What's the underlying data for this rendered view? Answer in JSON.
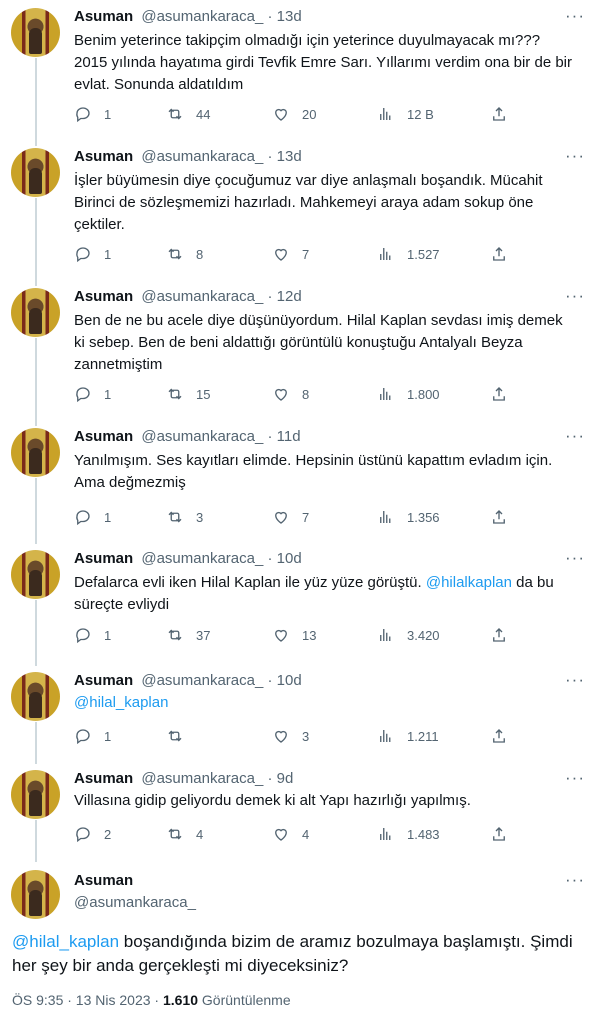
{
  "author": {
    "name": "Asuman",
    "handle": "@asumankaraca_",
    "separator": "·",
    "more": "···"
  },
  "tweets": [
    {
      "time": "13d",
      "lines": [
        "Benim yeterince takipçim olmadığı için yeterince duyulmayacak mı???",
        "2015 yılında hayatıma girdi Tevfik Emre Sarı. Yıllarımı verdim ona bir de bir",
        "evlat. Sonunda aldatıldım"
      ],
      "replies": "1",
      "retweets": "44",
      "likes": "20",
      "views": "12 B"
    },
    {
      "time": "13d",
      "lines": [
        "İşler büyümesin diye çocuğumuz var diye anlaşmalı boşandık. Mücahit",
        "Birinci de sözleşmemizi hazırladı. Mahkemeyi araya adam sokup öne",
        "çektiler."
      ],
      "replies": "1",
      "retweets": "8",
      "likes": "7",
      "views": "1.527"
    },
    {
      "time": "12d",
      "lines": [
        "Ben de ne bu acele diye düşünüyordum. Hilal Kaplan sevdası imiş demek",
        "ki sebep. Ben de beni aldattığı görüntülü konuştuğu Antalyalı Beyza",
        "zannetmiştim"
      ],
      "replies": "1",
      "retweets": "15",
      "likes": "8",
      "views": "1.800"
    },
    {
      "time": "11d",
      "lines": [
        "Yanılmışım. Ses kayıtları elimde. Hepsinin üstünü kapattım evladım için.",
        "Ama değmezmiş"
      ],
      "replies": "1",
      "retweets": "3",
      "likes": "7",
      "views": "1.356"
    },
    {
      "time": "10d",
      "line_pre": "Defalarca evli iken Hilal Kaplan ile yüz yüze görüştü.",
      "mention": "@hilalkaplan",
      "line_post": "da bu",
      "line2": "süreçte evliydi",
      "replies": "1",
      "retweets": "37",
      "likes": "13",
      "views": "3.420"
    },
    {
      "time": "10d",
      "mention": "@hilal_kaplan",
      "replies": "1",
      "retweets": "",
      "likes": "3",
      "views": "1.211"
    },
    {
      "time": "9d",
      "lines": [
        "Villasına gidip geliyordu demek ki alt Yapı hazırlığı yapılmış."
      ],
      "replies": "2",
      "retweets": "4",
      "likes": "4",
      "views": "1.483"
    }
  ],
  "final": {
    "name": "Asuman",
    "handle": "@asumankaraca_",
    "mention": "@hilal_kaplan",
    "text_line1": "boşandığında bizim de aramız bozulmaya başlamıştı. Şimdi",
    "text_line2": "her şey bir anda gerçekleşti mi diyeceksiniz?",
    "timestamp": "ÖS 9:35 · 13 Nis 2023 ·",
    "views_count": "1.610",
    "views_label": "Görüntülenme"
  },
  "icons": [
    "reply-icon",
    "retweet-icon",
    "like-icon",
    "views-icon",
    "share-icon",
    "more-icon"
  ],
  "colors": {
    "text": "#0f1419",
    "secondary": "#536471",
    "link": "#1d9bf0",
    "thread_line": "#cfd9de"
  }
}
